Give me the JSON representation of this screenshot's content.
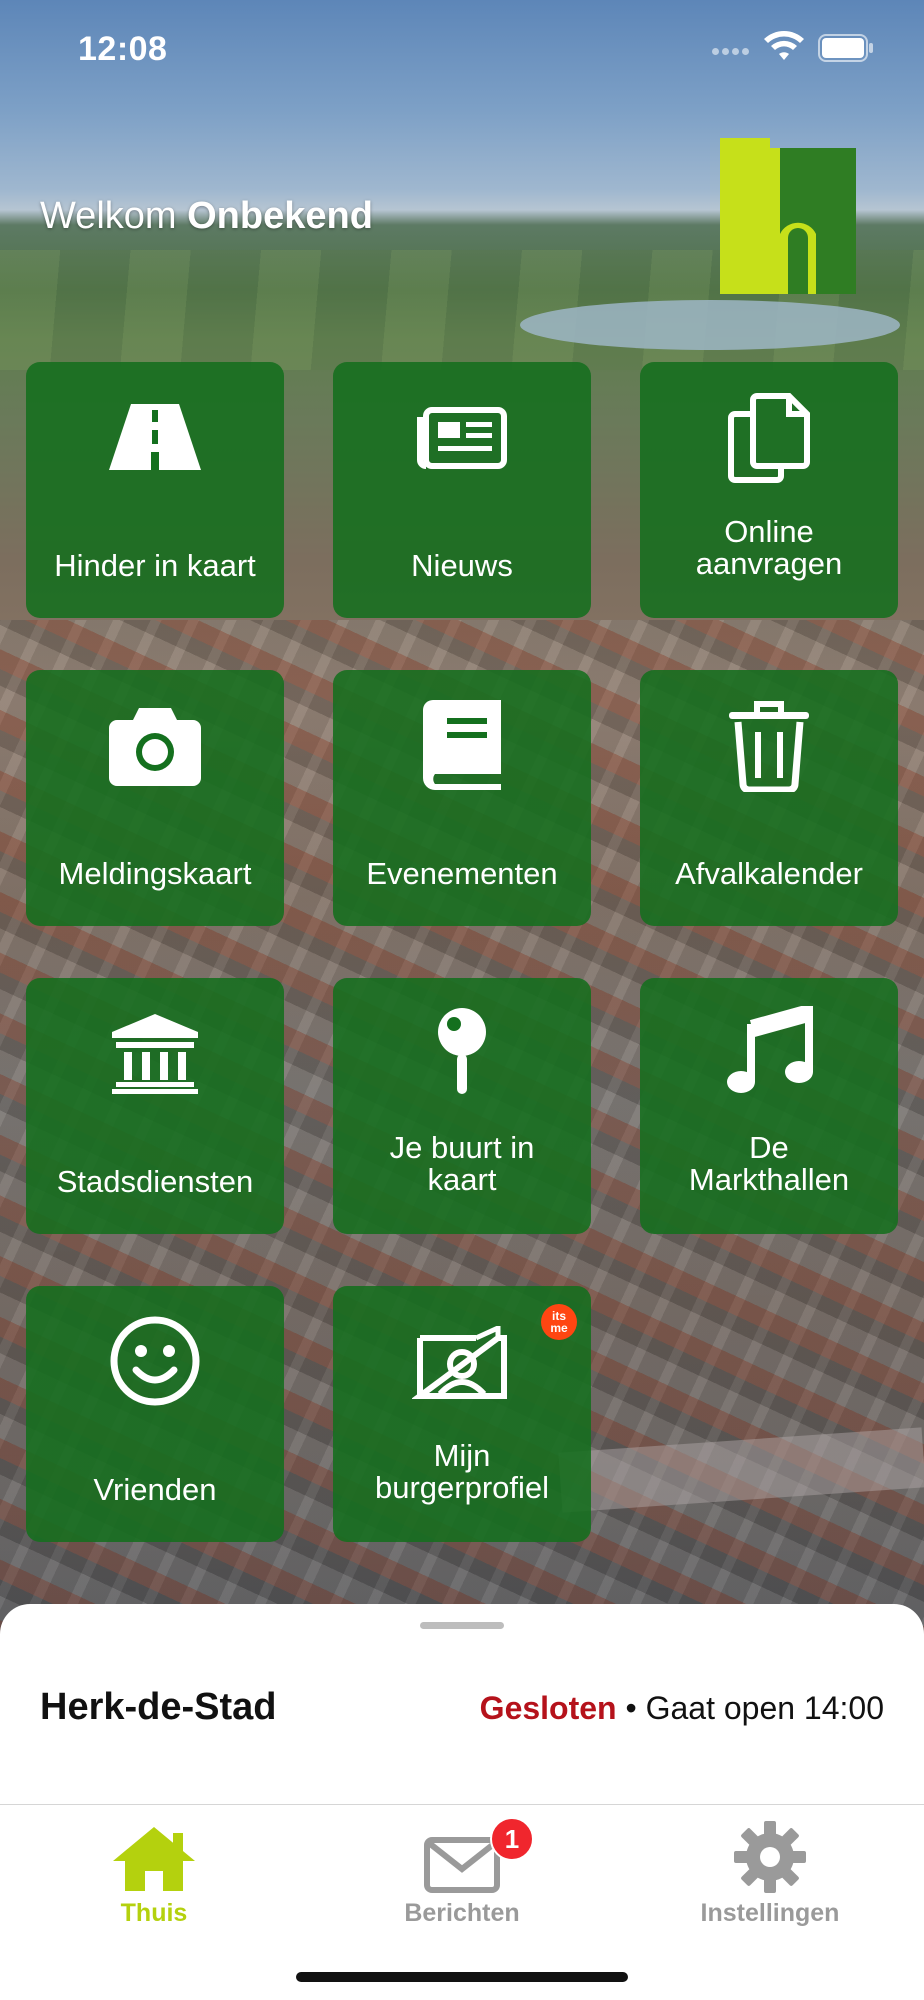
{
  "status_bar": {
    "time": "12:08"
  },
  "header": {
    "welcome_prefix": "Welkom",
    "welcome_name": "Onbekend",
    "logo_icon": "city-logo-icon",
    "colors": {
      "logo_light": "#c6e01a",
      "logo_dark": "#2f7d23"
    }
  },
  "tiles": [
    {
      "label": "Hinder in kaart",
      "icon": "road-icon"
    },
    {
      "label": "Nieuws",
      "icon": "newspaper-icon"
    },
    {
      "label": "Online\naanvragen",
      "icon": "copy-documents-icon"
    },
    {
      "label": "Meldingskaart",
      "icon": "camera-icon"
    },
    {
      "label": "Evenementen",
      "icon": "book-icon"
    },
    {
      "label": "Afvalkalender",
      "icon": "trash-icon"
    },
    {
      "label": "Stadsdiensten",
      "icon": "institution-icon"
    },
    {
      "label": "Je buurt in\nkaart",
      "icon": "map-pin-icon"
    },
    {
      "label": "De\nMarkthallen",
      "icon": "music-note-icon"
    },
    {
      "label": "Vrienden",
      "icon": "smiley-icon"
    },
    {
      "label": "Mijn\nburgerprofiel",
      "icon": "profile-card-icon",
      "badge": "its\nme"
    }
  ],
  "opening": {
    "place": "Herk-de-Stad",
    "state": "Gesloten",
    "separator": "•",
    "next": "Gaat open 14:00"
  },
  "tabbar": [
    {
      "label": "Thuis",
      "icon": "home-icon",
      "active": true
    },
    {
      "label": "Berichten",
      "icon": "mail-icon",
      "badge": "1"
    },
    {
      "label": "Instellingen",
      "icon": "gear-icon"
    }
  ],
  "colors": {
    "tile": "#14701e",
    "accent": "#b4d10e",
    "closed": "#b5121b",
    "badge": "#f0262d"
  }
}
